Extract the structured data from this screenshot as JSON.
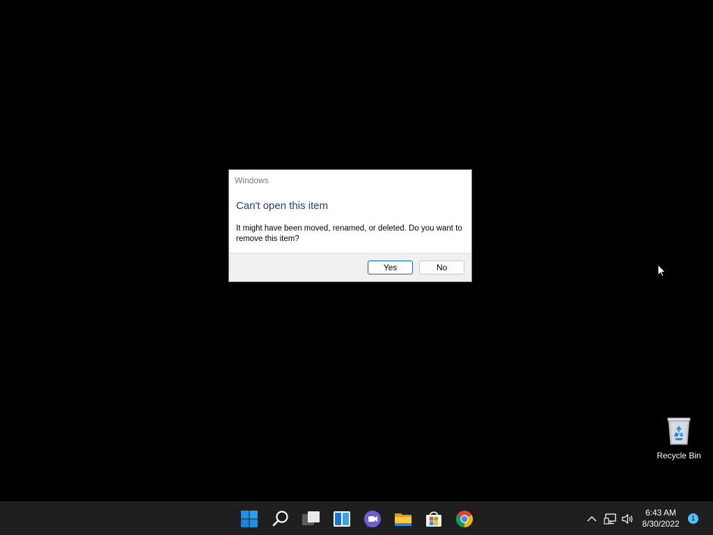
{
  "dialog": {
    "window_title": "Windows",
    "heading": "Can't open this item",
    "message": "It might have been moved, renamed, or deleted. Do you want to remove this item?",
    "yes_label": "Yes",
    "no_label": "No"
  },
  "desktop": {
    "recycle_bin_label": "Recycle Bin"
  },
  "taskbar": {
    "pinned": [
      "start-icon",
      "search-icon",
      "task-view-icon",
      "widgets-icon",
      "teams-chat-icon",
      "file-explorer-icon",
      "microsoft-store-icon",
      "chrome-icon"
    ],
    "time": "6:43 AM",
    "date": "8/30/2022",
    "notification_count": "1"
  },
  "colors": {
    "accent": "#0067c0",
    "heading": "#1c3f7a",
    "taskbar": "#1f1f1f",
    "badge": "#4cc2ff"
  }
}
